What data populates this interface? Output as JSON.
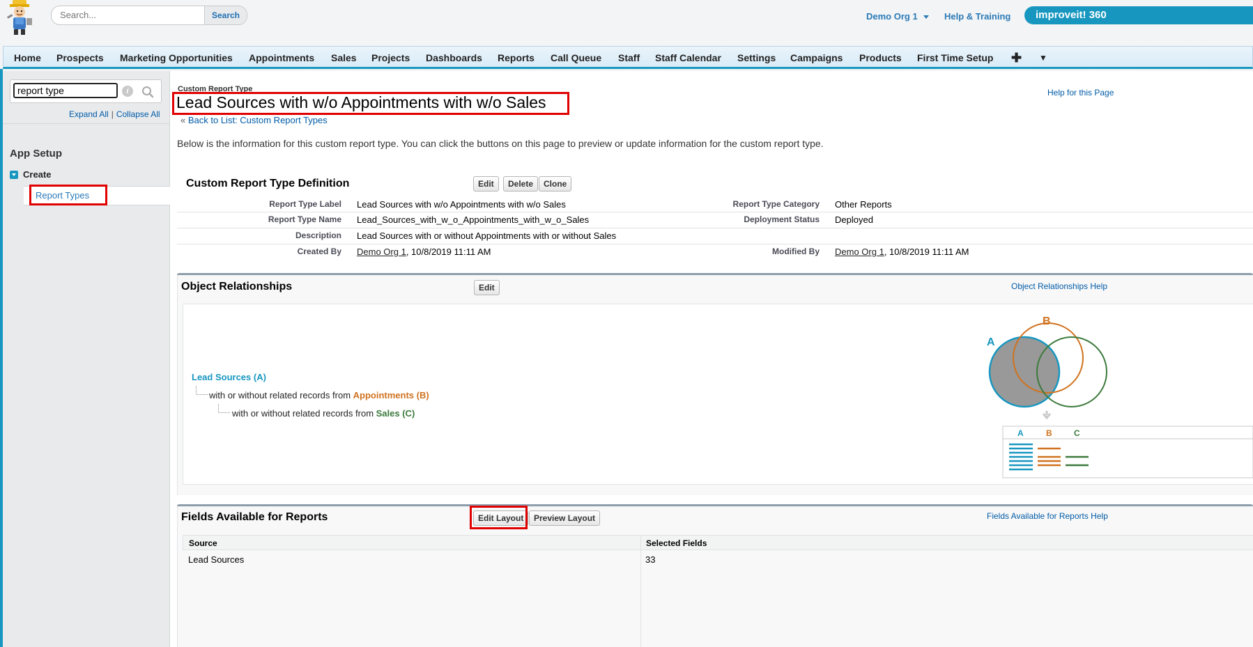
{
  "header": {
    "search_placeholder": "Search...",
    "search_button": "Search",
    "org_menu": "Demo Org 1",
    "help_link": "Help & Training",
    "brand": "improveit! 360"
  },
  "tabs": [
    "Home",
    "Prospects",
    "Marketing Opportunities",
    "Appointments",
    "Sales",
    "Projects",
    "Dashboards",
    "Reports",
    "Call Queue",
    "Staff",
    "Staff Calendar",
    "Settings",
    "Campaigns",
    "Products",
    "First Time Setup"
  ],
  "sidebar": {
    "search_value": "report type",
    "expand_all": "Expand All",
    "separator": "|",
    "collapse_all": "Collapse All",
    "app_setup": "App Setup",
    "create": "Create",
    "report_types": "Report Types"
  },
  "page": {
    "breadcrumb_label": "Custom Report Type",
    "title": "Lead Sources with w/o Appointments with w/o Sales",
    "help_link": "Help for this Page",
    "back_prefix": "«",
    "back_link": "Back to List: Custom Report Types",
    "description": "Below is the information for this custom report type. You can click the buttons on this page to preview or update information for the custom report type."
  },
  "definition": {
    "title": "Custom Report Type Definition",
    "buttons": {
      "edit": "Edit",
      "delete": "Delete",
      "clone": "Clone"
    },
    "report_type_label_k": "Report Type Label",
    "report_type_label_v": "Lead Sources with w/o Appointments with w/o Sales",
    "report_type_name_k": "Report Type Name",
    "report_type_name_v": "Lead_Sources_with_w_o_Appointments_with_w_o_Sales",
    "description_k": "Description",
    "description_v": "Lead Sources with or without Appointments with or without Sales",
    "created_by_k": "Created By",
    "created_by_user": "Demo Org 1",
    "created_by_date": ", 10/8/2019 11:11 AM",
    "category_k": "Report Type Category",
    "category_v": "Other Reports",
    "deployment_k": "Deployment Status",
    "deployment_v": "Deployed",
    "modified_by_k": "Modified By",
    "modified_by_user": "Demo Org 1",
    "modified_by_date": ", 10/8/2019 11:11 AM"
  },
  "relationships": {
    "title": "Object Relationships",
    "edit": "Edit",
    "help": "Object Relationships Help",
    "a": "Lead Sources (A)",
    "b_prefix": "with or without related records from ",
    "b": "Appointments (B)",
    "c_prefix": "with or without related records from ",
    "c": "Sales (C)",
    "venn": {
      "a": "A",
      "b": "B",
      "col_a": "A",
      "col_b": "B",
      "col_c": "C"
    }
  },
  "fields": {
    "title": "Fields Available for Reports",
    "edit_layout": "Edit Layout",
    "preview_layout": "Preview Layout",
    "help": "Fields Available for Reports Help",
    "col_source": "Source",
    "col_selected": "Selected Fields",
    "rows": [
      {
        "source": "Lead Sources",
        "selected": "33"
      }
    ]
  },
  "colors": {
    "accent": "#1797c0",
    "highlight": "#e00000",
    "orange": "#d0721e",
    "green": "#3c7a3c"
  }
}
